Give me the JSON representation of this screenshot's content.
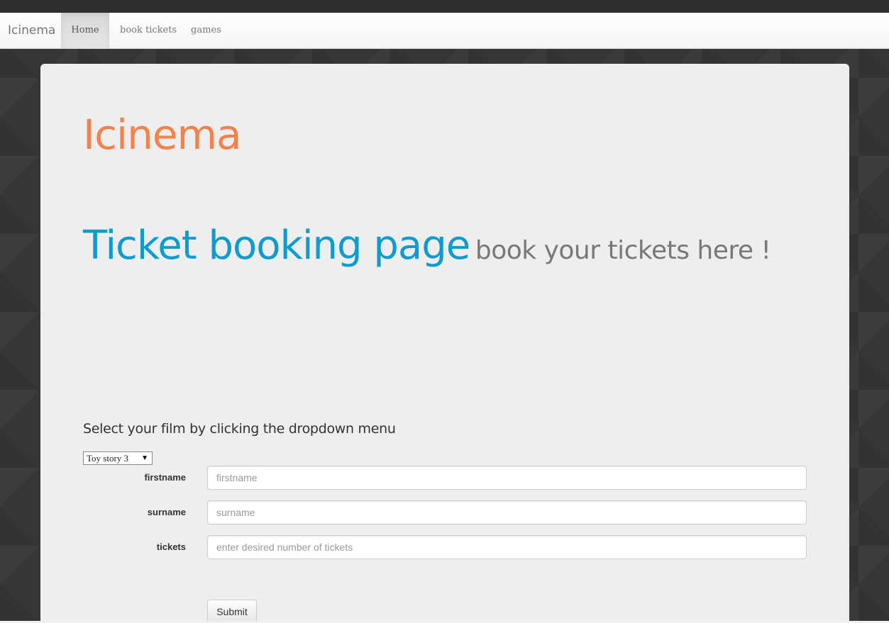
{
  "navbar": {
    "brand": "Icinema",
    "items": [
      {
        "label": "Home",
        "active": true
      },
      {
        "label": "book tickets",
        "active": false
      },
      {
        "label": "games",
        "active": false
      }
    ]
  },
  "hero": {
    "site_title": "Icinema",
    "heading_main": "Ticket booking page",
    "heading_sub": "book your tickets here !"
  },
  "form": {
    "instruction": "Select your film by clicking the dropdown menu",
    "film_select": {
      "selected": "Toy story 3",
      "arrow": "▼"
    },
    "fields": {
      "firstname": {
        "label": "firstname",
        "placeholder": "firstname",
        "value": ""
      },
      "surname": {
        "label": "surname",
        "placeholder": "surname",
        "value": ""
      },
      "tickets": {
        "label": "tickets",
        "placeholder": "enter desired number of tickets",
        "value": ""
      }
    },
    "submit_label": "Submit"
  },
  "colors": {
    "site_title": "#f4824a",
    "heading_main": "#0e9cd0",
    "heading_sub": "#787878",
    "page_background": "#363636",
    "panel_background": "#eeeeee"
  }
}
